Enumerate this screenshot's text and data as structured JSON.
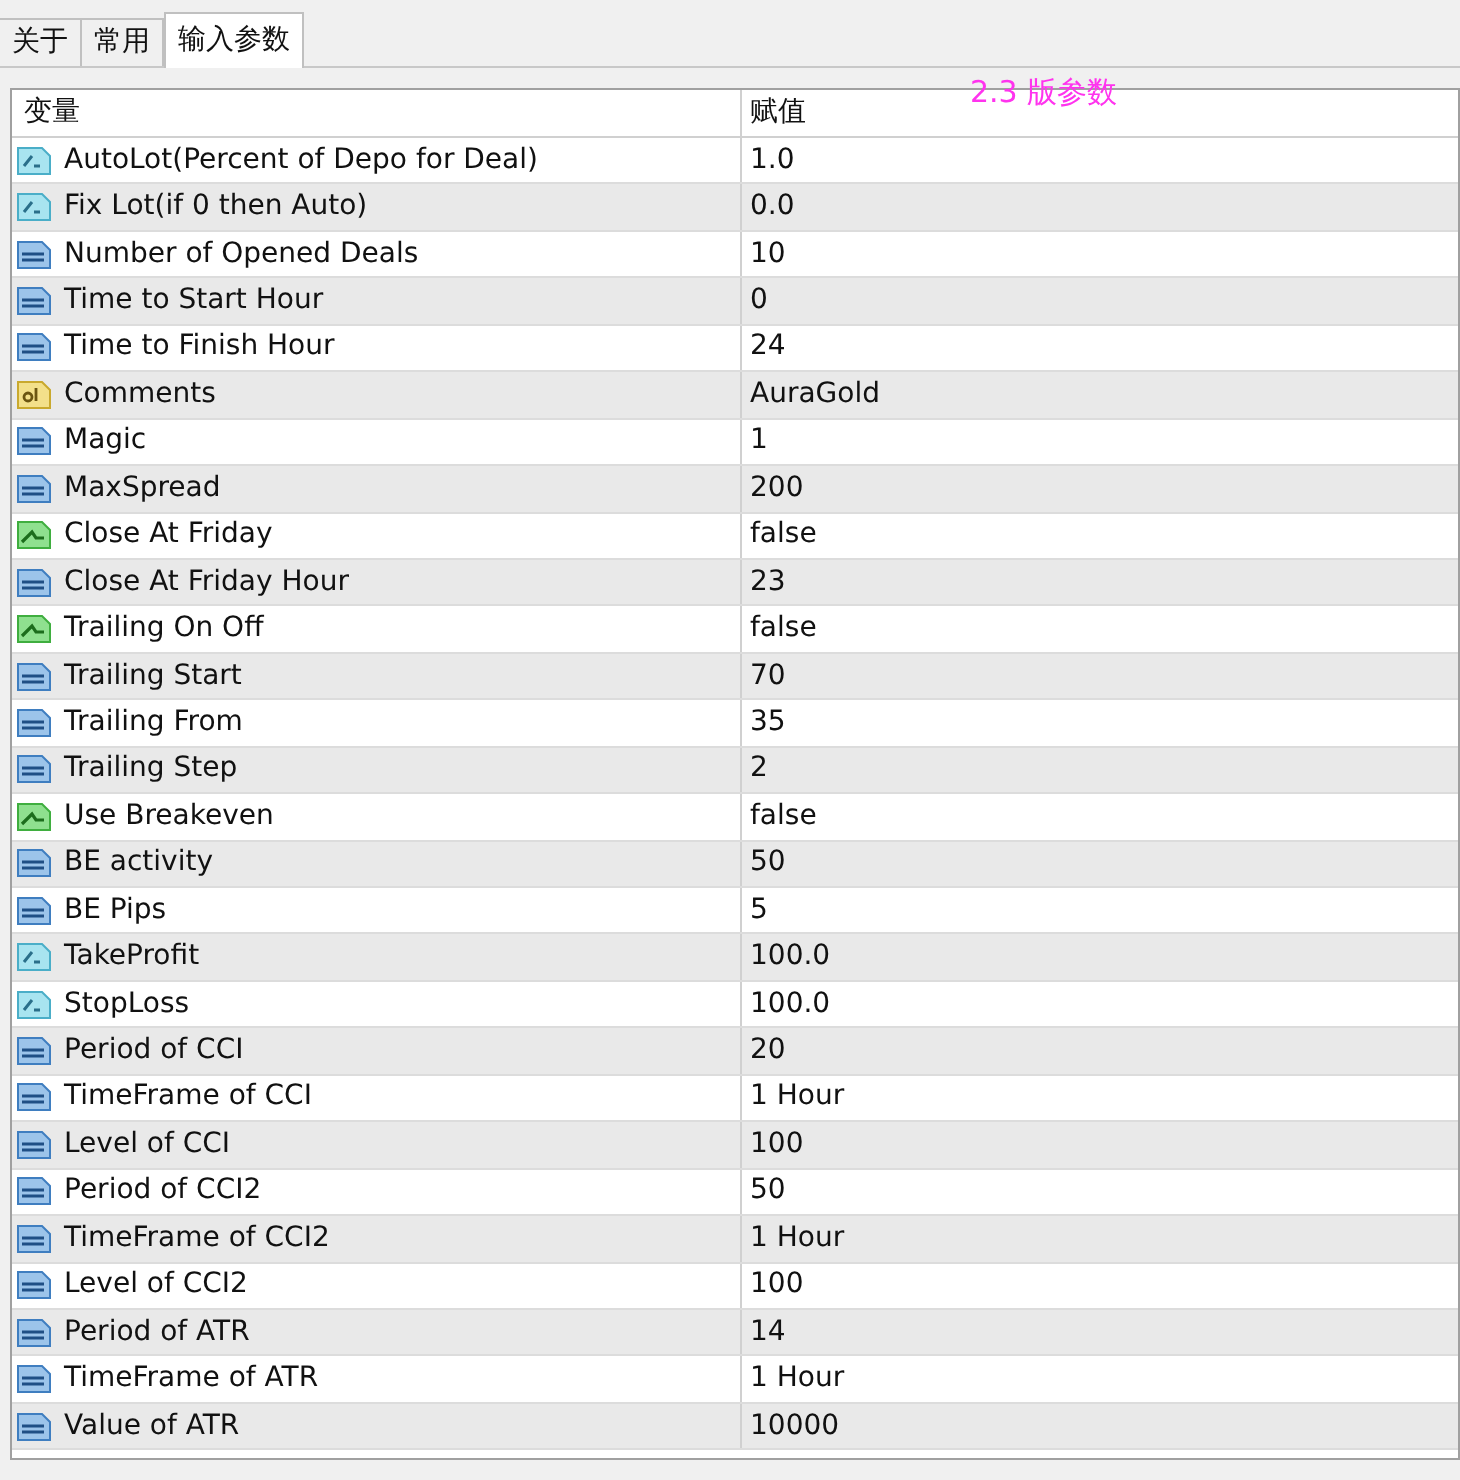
{
  "tabs": [
    {
      "label": "关于",
      "selected": false
    },
    {
      "label": "常用",
      "selected": false
    },
    {
      "label": "输入参数",
      "selected": true
    }
  ],
  "annotation": "2.3 版参数",
  "table": {
    "columns": [
      "变量",
      "赋值"
    ],
    "rows": [
      {
        "kind": "double",
        "name": "AutoLot(Percent of Depo for Deal)",
        "value": "1.0"
      },
      {
        "kind": "double",
        "name": "Fix Lot(if 0 then Auto)",
        "value": "0.0"
      },
      {
        "kind": "int",
        "name": "Number of Opened Deals",
        "value": "10"
      },
      {
        "kind": "int",
        "name": "Time to Start Hour",
        "value": "0"
      },
      {
        "kind": "int",
        "name": "Time to Finish Hour",
        "value": "24"
      },
      {
        "kind": "string",
        "name": "Comments",
        "value": "AuraGold"
      },
      {
        "kind": "int",
        "name": "Magic",
        "value": "1"
      },
      {
        "kind": "int",
        "name": "MaxSpread",
        "value": "200"
      },
      {
        "kind": "bool",
        "name": "Close At Friday",
        "value": "false"
      },
      {
        "kind": "int",
        "name": "Close At Friday Hour",
        "value": "23"
      },
      {
        "kind": "bool",
        "name": "Trailing On Off",
        "value": "false"
      },
      {
        "kind": "int",
        "name": "Trailing Start",
        "value": "70"
      },
      {
        "kind": "int",
        "name": "Trailing From",
        "value": "35"
      },
      {
        "kind": "int",
        "name": "Trailing Step",
        "value": "2"
      },
      {
        "kind": "bool",
        "name": "Use Breakeven",
        "value": "false"
      },
      {
        "kind": "int",
        "name": "BE activity",
        "value": "50"
      },
      {
        "kind": "int",
        "name": "BE Pips",
        "value": "5"
      },
      {
        "kind": "double",
        "name": "TakeProfit",
        "value": "100.0"
      },
      {
        "kind": "double",
        "name": "StopLoss",
        "value": "100.0"
      },
      {
        "kind": "int",
        "name": "Period of CCI",
        "value": "20"
      },
      {
        "kind": "int",
        "name": "TimeFrame of CCI",
        "value": "1 Hour"
      },
      {
        "kind": "int",
        "name": "Level of CCI",
        "value": "100"
      },
      {
        "kind": "int",
        "name": "Period of CCI2",
        "value": "50"
      },
      {
        "kind": "int",
        "name": "TimeFrame of CCI2",
        "value": "1 Hour"
      },
      {
        "kind": "int",
        "name": "Level of CCI2",
        "value": "100"
      },
      {
        "kind": "int",
        "name": "Period of ATR",
        "value": "14"
      },
      {
        "kind": "int",
        "name": "TimeFrame of ATR",
        "value": "1 Hour"
      },
      {
        "kind": "int",
        "name": "Value of ATR",
        "value": "10000"
      }
    ]
  }
}
